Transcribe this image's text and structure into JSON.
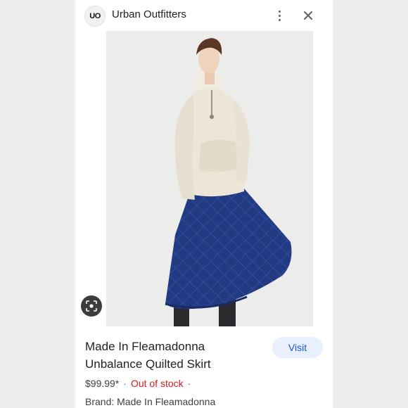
{
  "header": {
    "logo_text": "UO",
    "site_name": "Urban Outfitters",
    "menu_icon": "more-vert-icon",
    "close_icon": "close-icon"
  },
  "image": {
    "lens_icon": "lens-search-icon"
  },
  "product": {
    "title": "Made In Fleamadonna Unbalance Quilted Skirt",
    "price": "$99.99*",
    "separator": "·",
    "stock_status": "Out of stock",
    "brand": "Brand: Made In Fleamadonna"
  },
  "actions": {
    "visit_label": "Visit"
  },
  "colors": {
    "accent": "#1a56d6",
    "button_bg": "#e8f0fe",
    "out_of_stock": "#c5221f"
  }
}
